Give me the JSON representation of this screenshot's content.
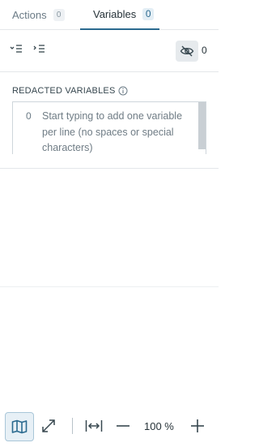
{
  "tabs": [
    {
      "label": "Actions",
      "count": "0"
    },
    {
      "label": "Variables",
      "count": "0"
    }
  ],
  "toolbar": {
    "collapse_icon": "collapse-all-icon",
    "expand_icon": "expand-all-icon",
    "visibility_icon": "eye-off-icon",
    "hidden_count": "0"
  },
  "redacted": {
    "title": "REDACTED VARIABLES",
    "line_number": "0",
    "placeholder": "Start typing to add one variable per line (no spaces or special characters)"
  },
  "bottom": {
    "map_icon": "map-icon",
    "fullscreen_icon": "expand-arrows-icon",
    "fit_icon": "fit-width-icon",
    "zoom_out_icon": "minus-icon",
    "zoom_level": "100 %",
    "zoom_in_icon": "plus-icon"
  },
  "colors": {
    "accent": "#2b6a8f",
    "text": "#37474f",
    "muted": "#6b7b86"
  }
}
